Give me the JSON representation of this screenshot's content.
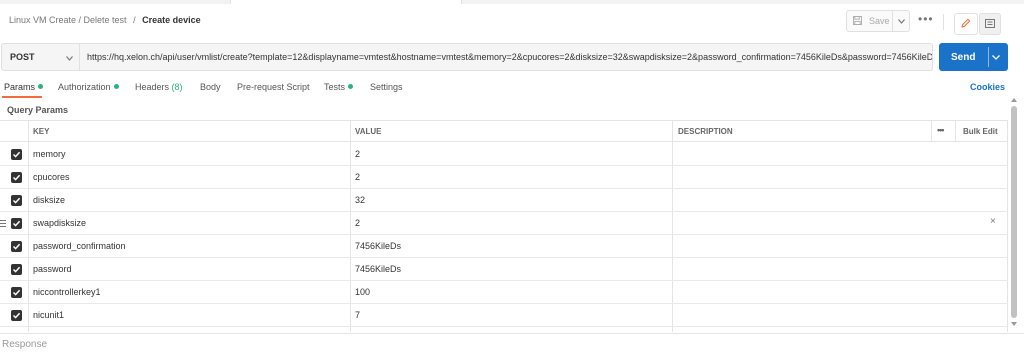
{
  "breadcrumb": {
    "collection": "Linux VM Create / Delete test",
    "separator": "/",
    "request": "Create device"
  },
  "toolbar": {
    "save_label": "Save",
    "more_label": "•••"
  },
  "request": {
    "method": "POST",
    "url": "https://hq.xelon.ch/api/user/vmlist/create?template=12&displayname=vmtest&hostname=vmtest&memory=2&cpucores=2&disksize=32&swapdisksize=2&password_confirmation=7456KileDs&password=7456KileDs&nc",
    "send_label": "Send"
  },
  "tabs": [
    {
      "label": "Params",
      "dot": true
    },
    {
      "label": "Authorization",
      "dot": true
    },
    {
      "label": "Headers",
      "count": "(8)"
    },
    {
      "label": "Body"
    },
    {
      "label": "Pre-request Script"
    },
    {
      "label": "Tests",
      "dot": true
    },
    {
      "label": "Settings"
    }
  ],
  "cookies_label": "Cookies",
  "query_params": {
    "title": "Query Params",
    "headers": {
      "key": "KEY",
      "value": "VALUE",
      "description": "DESCRIPTION",
      "more": "•••",
      "bulk_edit": "Bulk Edit"
    },
    "rows": [
      {
        "key": "memory",
        "value": "2",
        "checked": true
      },
      {
        "key": "cpucores",
        "value": "2",
        "checked": true
      },
      {
        "key": "disksize",
        "value": "32",
        "checked": true
      },
      {
        "key": "swapdisksize",
        "value": "2",
        "checked": true
      },
      {
        "key": "password_confirmation",
        "value": "7456KileDs",
        "checked": true
      },
      {
        "key": "password",
        "value": "7456KileDs",
        "checked": true
      },
      {
        "key": "niccontrollerkey1",
        "value": "100",
        "checked": true
      },
      {
        "key": "nicunit1",
        "value": "7",
        "checked": true
      },
      {
        "key": "",
        "value": "",
        "checked": true
      }
    ]
  },
  "response": {
    "label": "Response"
  },
  "colors": {
    "accent": "#1a73c8",
    "active_tab": "#f26b3a",
    "status_dot": "#26b47f"
  }
}
